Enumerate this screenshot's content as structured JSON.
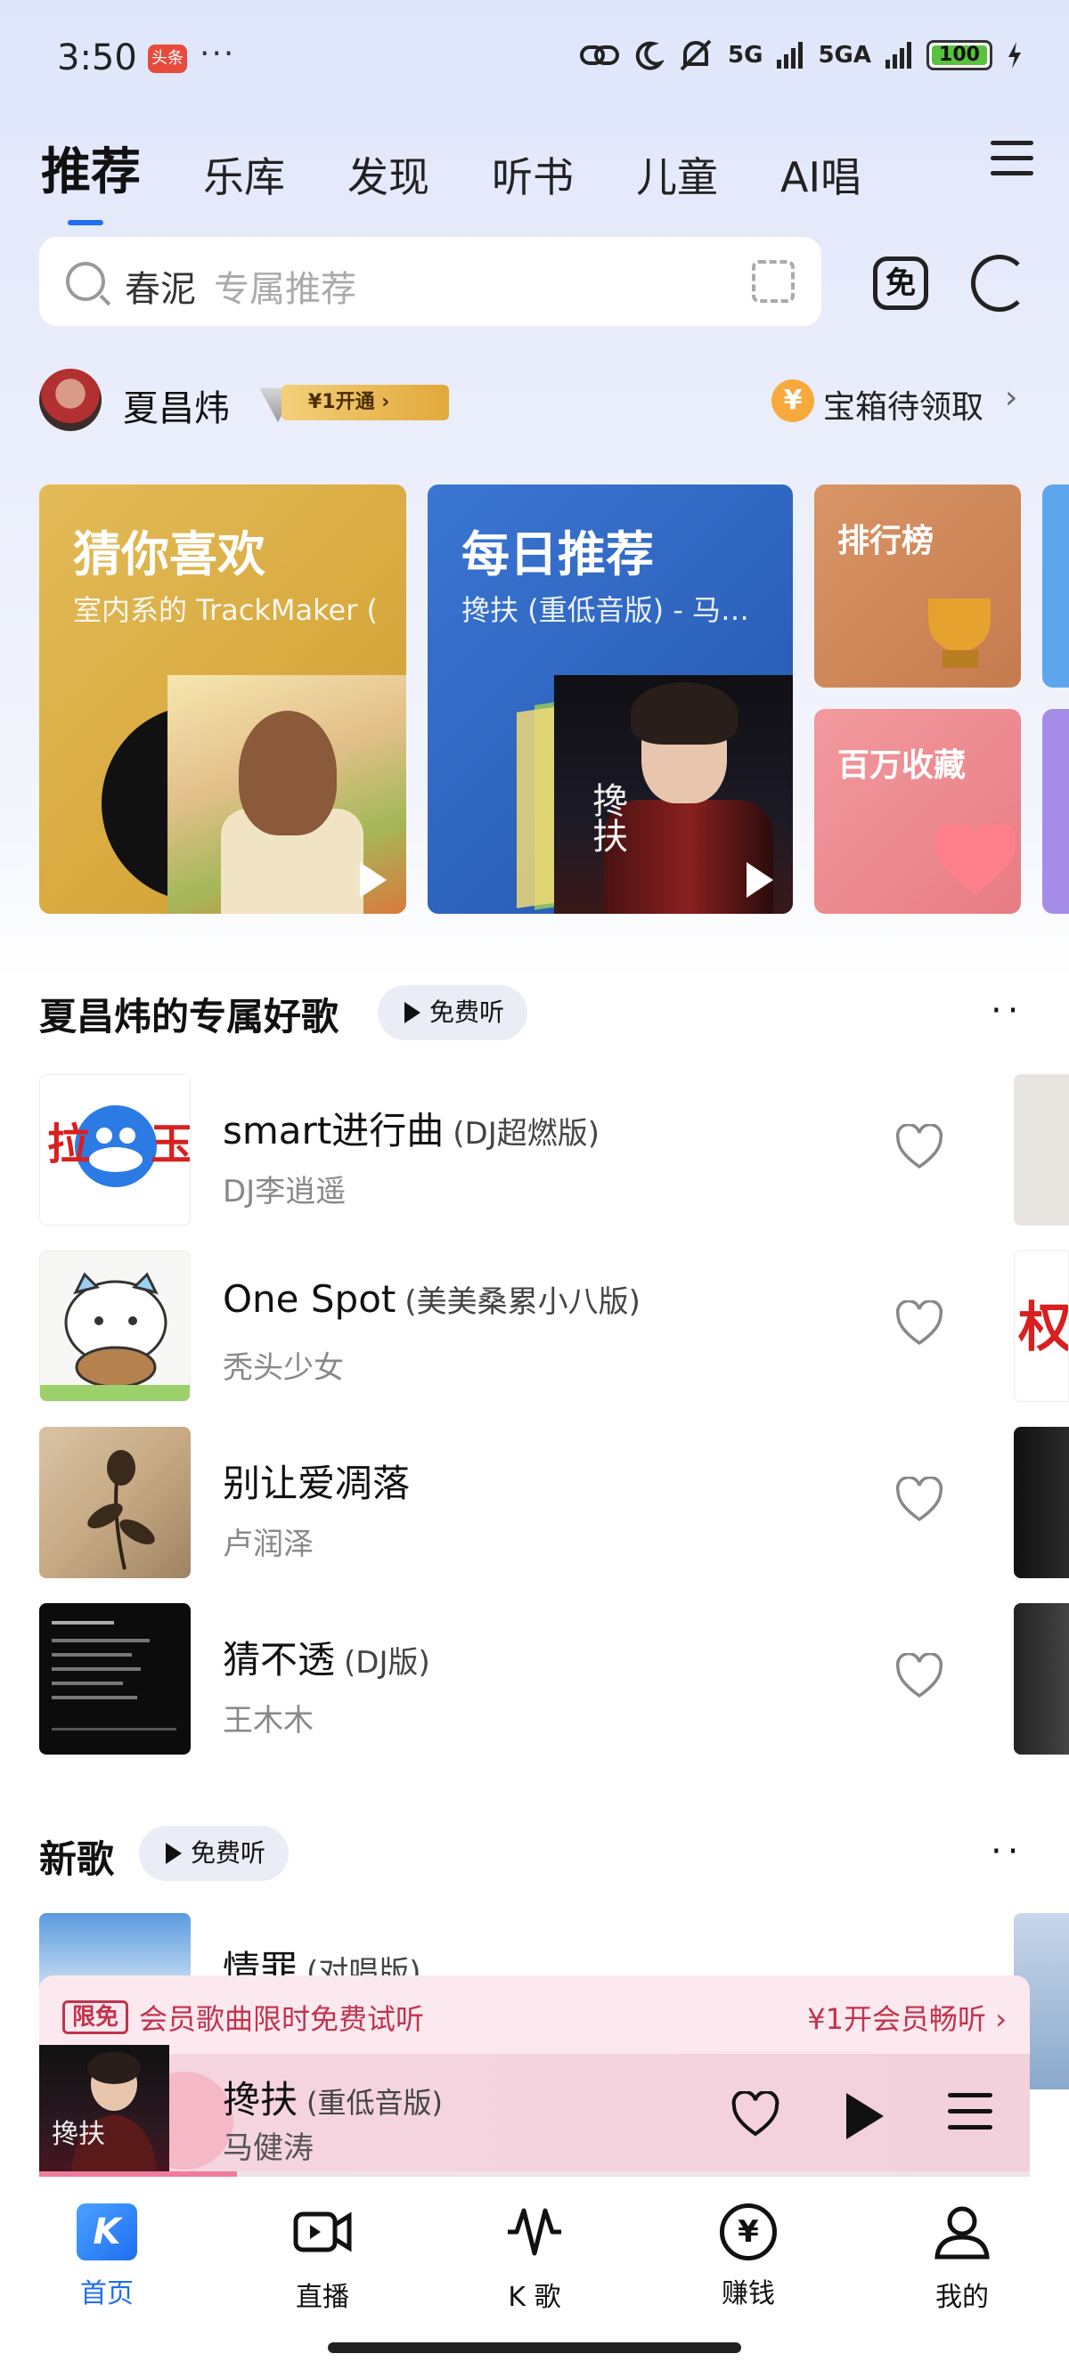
{
  "status_bar": {
    "time": "3:50",
    "badge": "头条",
    "dots": "···",
    "signal_1": "5G",
    "signal_2": "5GA",
    "battery": "100"
  },
  "tabs": [
    "推荐",
    "乐库",
    "发现",
    "听书",
    "儿童",
    "AI唱"
  ],
  "search": {
    "text": "春泥",
    "placeholder": "专属推荐"
  },
  "icons": {
    "free": "免"
  },
  "user": {
    "name": "夏昌炜",
    "vip_label": "¥1开通",
    "treasure_icon": "¥",
    "treasure_text": "宝箱待领取"
  },
  "banners": {
    "guess": {
      "title": "猜你喜欢",
      "subtitle": "室内系的 TrackMaker ("
    },
    "daily": {
      "title": "每日推荐",
      "subtitle": "搀扶 (重低音版) - 马…",
      "art_text": "搀扶"
    },
    "rank": {
      "title": "排行榜"
    },
    "fav": {
      "title": "百万收藏"
    }
  },
  "section_exclusive": {
    "title": "夏昌炜的专属好歌",
    "free_label": "免费听",
    "songs": [
      {
        "title": "smart进行曲",
        "version": "(DJ超燃版)",
        "artist": "DJ李逍遥"
      },
      {
        "title": "One Spot",
        "version": "(美美桑累小八版)",
        "artist": "秃头少女"
      },
      {
        "title": "别让爱凋落",
        "version": "",
        "artist": "卢润泽"
      },
      {
        "title": "猜不透",
        "version": "(DJ版)",
        "artist": "王木木"
      }
    ]
  },
  "section_new": {
    "title": "新歌",
    "free_label": "免费听",
    "songs": [
      {
        "title": "情罪",
        "version": "(对唱版)"
      }
    ]
  },
  "promo": {
    "tag": "限免",
    "text": "会员歌曲限时免费试听",
    "action": "¥1开会员畅听 ›"
  },
  "player": {
    "title": "搀扶",
    "version": "(重低音版)",
    "artist": "马健涛",
    "progress": 0.2
  },
  "bottom_nav": [
    {
      "label": "首页",
      "icon": "K"
    },
    {
      "label": "直播"
    },
    {
      "label": "K 歌"
    },
    {
      "label": "赚钱",
      "icon": "¥"
    },
    {
      "label": "我的"
    }
  ],
  "colors": {
    "accent": "#1f6ef2",
    "promo": "#c2334d"
  }
}
